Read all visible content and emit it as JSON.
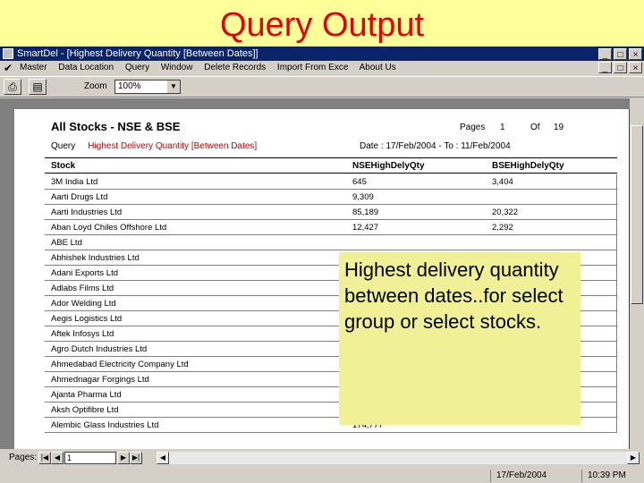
{
  "slide": {
    "title": "Query Output"
  },
  "window": {
    "title": "SmartDel - [Highest Delivery Quantity [Between Dates]]",
    "buttons": [
      "_",
      "□",
      "×"
    ],
    "mdi_buttons": [
      "_",
      "□",
      "×"
    ]
  },
  "menu": [
    "Master",
    "Data Location",
    "Query",
    "Window",
    "Delete Records",
    "Import From Exce",
    "About Us"
  ],
  "toolbar": {
    "zoom_label": "Zoom",
    "zoom_value": "100%"
  },
  "report": {
    "title": "All Stocks - NSE & BSE",
    "pages_label": "Pages",
    "page_current": "1",
    "of_label": "Of",
    "page_total": "19",
    "query_label": "Query",
    "query_value": "Highest Delivery Quantity [Between Dates]",
    "dates": "Date : 17/Feb/2004 - To : 11/Feb/2004",
    "headers": [
      "Stock",
      "NSEHighDelyQty",
      "BSEHighDelyQty"
    ],
    "rows": [
      [
        "3M India Ltd",
        "645",
        "3,404"
      ],
      [
        "Aarti Drugs Ltd",
        "9,309",
        ""
      ],
      [
        "Aarti Industries Ltd",
        "85,189",
        "20,322"
      ],
      [
        "Aban Loyd Chiles Offshore Ltd",
        "12,427",
        "2,292"
      ],
      [
        "ABE Ltd",
        "",
        ""
      ],
      [
        "Abhishek Industries Ltd",
        "",
        ""
      ],
      [
        "Adani Exports Ltd",
        "",
        ""
      ],
      [
        "Adlabs Films Ltd",
        "",
        ""
      ],
      [
        "Ador Welding Ltd",
        "",
        ""
      ],
      [
        "Aegis Logistics Ltd",
        "",
        ""
      ],
      [
        "Aftek Infosys Ltd",
        "",
        ""
      ],
      [
        "Agro Dutch Industries Ltd",
        "",
        ""
      ],
      [
        "Ahmedabad Electricity Company Ltd",
        "",
        ""
      ],
      [
        "Ahmednagar Forgings Ltd",
        "",
        ""
      ],
      [
        "Ajanta Pharma Ltd",
        "",
        ""
      ],
      [
        "Aksh Optifibre Ltd",
        "",
        ""
      ],
      [
        "Alembic Glass Industries Ltd",
        "174,777",
        ""
      ]
    ]
  },
  "statusbar": {
    "pages_label": "Pages:",
    "page_input": "1",
    "date": "17/Feb/2004",
    "time": "10:39 PM"
  },
  "callout": {
    "text": "Highest delivery quantity between dates..for select group or select stocks."
  }
}
